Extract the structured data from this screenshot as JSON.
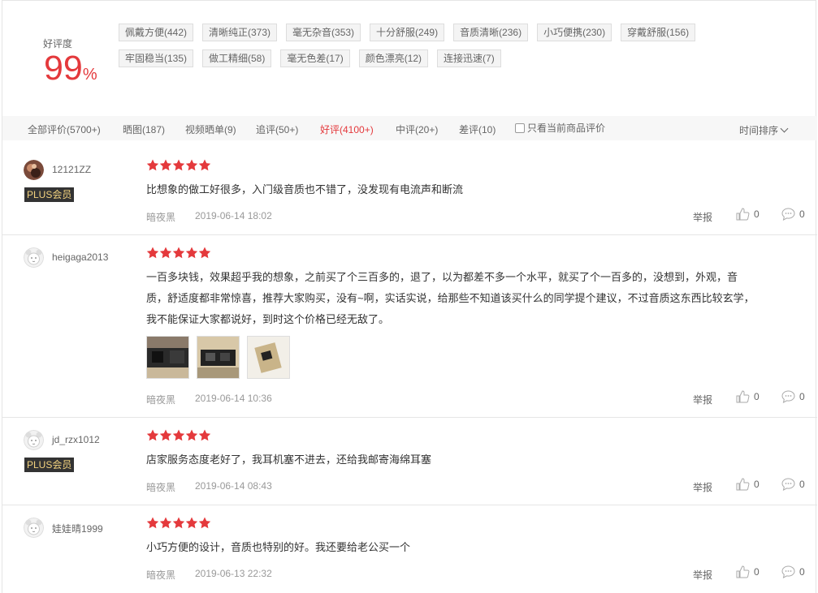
{
  "summary": {
    "rate_label": "好评度",
    "rate_value": "99",
    "rate_unit": "%",
    "tags_row1": [
      "佩戴方便(442)",
      "清晰纯正(373)",
      "毫无杂音(353)",
      "十分舒服(249)",
      "音质清晰(236)",
      "小巧便携(230)",
      "穿戴舒服(156)"
    ],
    "tags_row2": [
      "牢固稳当(135)",
      "做工精细(58)",
      "毫无色差(17)",
      "颜色漂亮(12)",
      "连接迅速(7)"
    ]
  },
  "filters": {
    "all": "全部评价(5700+)",
    "pics": "晒图(187)",
    "video": "视频晒单(9)",
    "followup": "追评(50+)",
    "good": "好评(4100+)",
    "medium": "中评(20+)",
    "bad": "差评(10)",
    "only_current": "只看当前商品评价",
    "sort": "时间排序"
  },
  "colors": {
    "accent": "#e4393c",
    "plus_bg": "#333333",
    "plus_text": "#f3d37f"
  },
  "reviews": [
    {
      "user": "12121ZZ",
      "plus": "PLUS会员",
      "rating": 5,
      "content": "比想象的做工好很多，入门级音质也不错了，没发现有电流声和断流",
      "color": "暗夜黑",
      "date": "2019-06-14 18:02",
      "report": "举报",
      "likes": "0",
      "replies": "0"
    },
    {
      "user": "heigaga2013",
      "rating": 5,
      "content_lines": [
        "一百多块钱，效果超乎我的想象，之前买了个三百多的，退了，以为都差不多一个水平，就买了个一百多的，没想到，外观，音",
        "质，舒适度都非常惊喜，推荐大家购买，没有~啊，实话实说，给那些不知道该买什么的同学提个建议，不过音质这东西比较玄学，",
        "我不能保证大家都说好，到时这个价格已经无敌了。"
      ],
      "color": "暗夜黑",
      "date": "2019-06-14 10:36",
      "report": "举报",
      "likes": "0",
      "replies": "0"
    },
    {
      "user": "jd_rzx1012",
      "plus": "PLUS会员",
      "rating": 5,
      "content": "店家服务态度老好了，我耳机塞不进去，还给我邮寄海绵耳塞",
      "color": "暗夜黑",
      "date": "2019-06-14 08:43",
      "report": "举报",
      "likes": "0",
      "replies": "0"
    },
    {
      "user": "娃娃晴1999",
      "rating": 5,
      "content": "小巧方便的设计，音质也特别的好。我还要给老公买一个",
      "color": "暗夜黑",
      "date": "2019-06-13 22:32",
      "report": "举报",
      "likes": "0",
      "replies": "0"
    }
  ]
}
